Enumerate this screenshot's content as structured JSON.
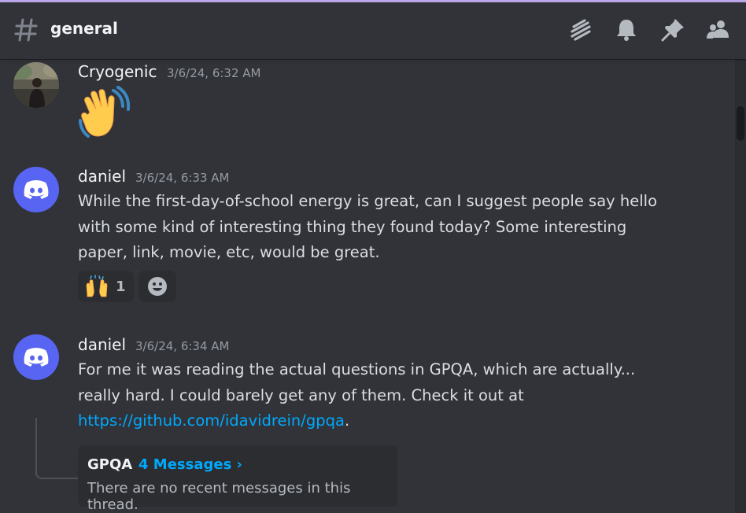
{
  "header": {
    "channel_name": "general",
    "icons": [
      "threads-icon",
      "bell-icon",
      "pin-icon",
      "members-icon"
    ]
  },
  "messages": [
    {
      "username": "Cryogenic",
      "timestamp": "3/6/24, 6:32 AM",
      "content_emoji": "waving-hand"
    },
    {
      "username": "daniel",
      "timestamp": "3/6/24, 6:33 AM",
      "text_lines": [
        "While the first-day-of-school energy is great, can I suggest people say hello",
        "with some kind of interesting thing they found today? Some interesting",
        "paper, link, movie, etc, would be great."
      ],
      "reactions": [
        {
          "emoji": "raising-hands",
          "count": "1"
        }
      ],
      "add_reaction_icon": "smiley-icon"
    },
    {
      "username": "daniel",
      "timestamp": "3/6/24, 6:34 AM",
      "text_lines": [
        "For me it was reading the actual questions in GPQA, which are actually...",
        "really hard. I could barely get any of them. Check it out at"
      ],
      "link": "https://github.com/idavidrein/gpqa",
      "link_suffix": ".",
      "thread": {
        "name": "GPQA",
        "count_label": "4 Messages ›",
        "subtitle": "There are no recent messages in this thread."
      }
    }
  ],
  "colors": {
    "background": "#313338",
    "blurple": "#5865f2",
    "link": "#00a8fc",
    "timestamp": "#949ba4"
  }
}
